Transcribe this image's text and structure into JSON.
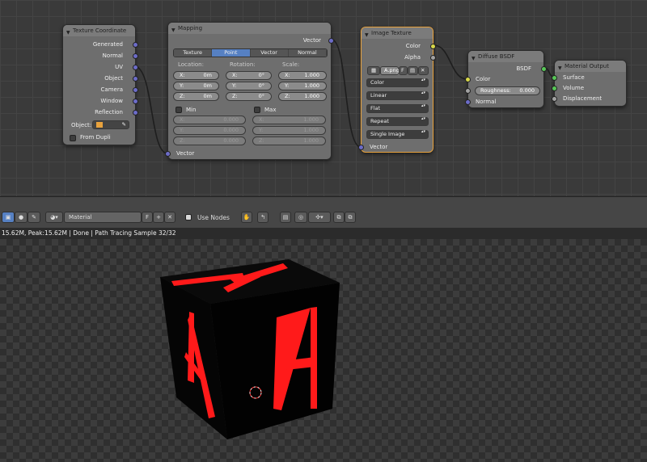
{
  "nodes": {
    "texcoord": {
      "title": "Texture Coordinate",
      "outputs": [
        "Generated",
        "Normal",
        "UV",
        "Object",
        "Camera",
        "Window",
        "Reflection"
      ],
      "object_label": "Object:",
      "from_dupli": "From Dupli"
    },
    "mapping": {
      "title": "Mapping",
      "output_label": "Vector",
      "input_label": "Vector",
      "types": [
        "Texture",
        "Point",
        "Vector",
        "Normal"
      ],
      "active_type": "Point",
      "location_label": "Location:",
      "rotation_label": "Rotation:",
      "scale_label": "Scale:",
      "location": [
        {
          "axis": "X:",
          "value": "0m"
        },
        {
          "axis": "Y:",
          "value": "0m"
        },
        {
          "axis": "Z:",
          "value": "0m"
        }
      ],
      "rotation": [
        {
          "axis": "X:",
          "value": "0°"
        },
        {
          "axis": "Y:",
          "value": "0°"
        },
        {
          "axis": "Z:",
          "value": "0°"
        }
      ],
      "scale": [
        {
          "axis": "X:",
          "value": "1.000"
        },
        {
          "axis": "Y:",
          "value": "1.000"
        },
        {
          "axis": "Z:",
          "value": "1.000"
        }
      ],
      "min_label": "Min",
      "max_label": "Max",
      "min": [
        {
          "axis": "X:",
          "value": "0.000"
        },
        {
          "axis": "Y:",
          "value": "0.000"
        },
        {
          "axis": "Z:",
          "value": "0.000"
        }
      ],
      "max": [
        {
          "axis": "X:",
          "value": "1.000"
        },
        {
          "axis": "Y:",
          "value": "1.000"
        },
        {
          "axis": "Z:",
          "value": "1.000"
        }
      ]
    },
    "image": {
      "title": "Image Texture",
      "out_color": "Color",
      "out_alpha": "Alpha",
      "image_name": "A.png",
      "fake_user": "F",
      "color_mode": "Color",
      "interpolation": "Linear",
      "projection": "Flat",
      "extension": "Repeat",
      "source": "Single Image",
      "input_label": "Vector"
    },
    "diffuse": {
      "title": "Diffuse BSDF",
      "output_label": "BSDF",
      "in_color": "Color",
      "roughness_label": "Roughness:",
      "roughness_value": "0.000",
      "in_normal": "Normal"
    },
    "output": {
      "title": "Material Output",
      "inputs": [
        "Surface",
        "Volume",
        "Displacement"
      ]
    }
  },
  "header": {
    "material_name": "Material",
    "fake_user": "F",
    "use_nodes_label": "Use Nodes"
  },
  "status": "15.62M, Peak:15.62M | Done | Path Tracing Sample 32/32",
  "viewport": {
    "cube_letter": "A",
    "cube_face_color": "#000000",
    "letter_color": "#ff0000"
  }
}
